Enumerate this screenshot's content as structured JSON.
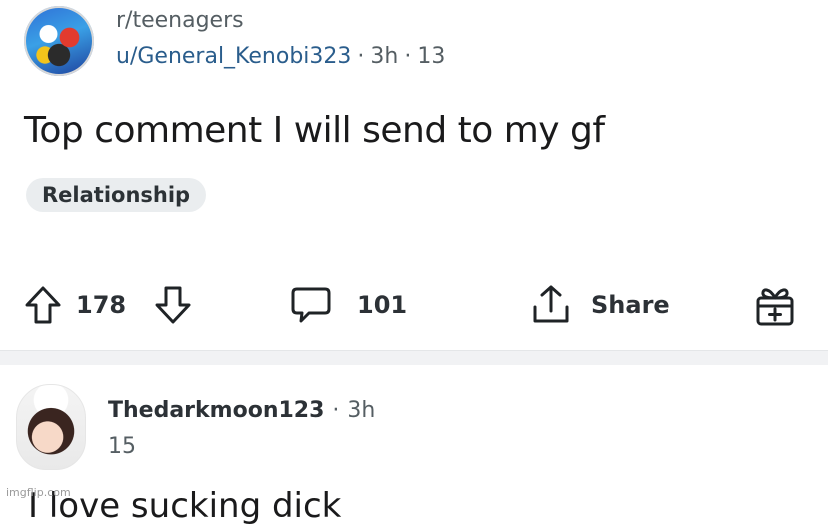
{
  "post": {
    "subreddit": "r/teenagers",
    "author": "u/General_Kenobi323",
    "time": "3h",
    "extra": "13",
    "separator": "·",
    "title": "Top comment I will send to my gf",
    "flair": "Relationship"
  },
  "actions": {
    "upvotes": "178",
    "comments": "101",
    "share": "Share"
  },
  "comment": {
    "author": "Thedarkmoon123",
    "separator": "·",
    "time": "3h",
    "score": "15",
    "body": "I love sucking dick"
  },
  "watermark": "imgflip.com",
  "colors": {
    "meta_gray": "#555e63",
    "username_blue": "#2a5d8c",
    "flair_bg": "#eaedef",
    "divider": "#f1f2f4"
  },
  "icons": [
    "subreddit-avatar",
    "upvote-icon",
    "downvote-icon",
    "comment-icon",
    "share-icon",
    "award-icon",
    "user-avatar"
  ]
}
